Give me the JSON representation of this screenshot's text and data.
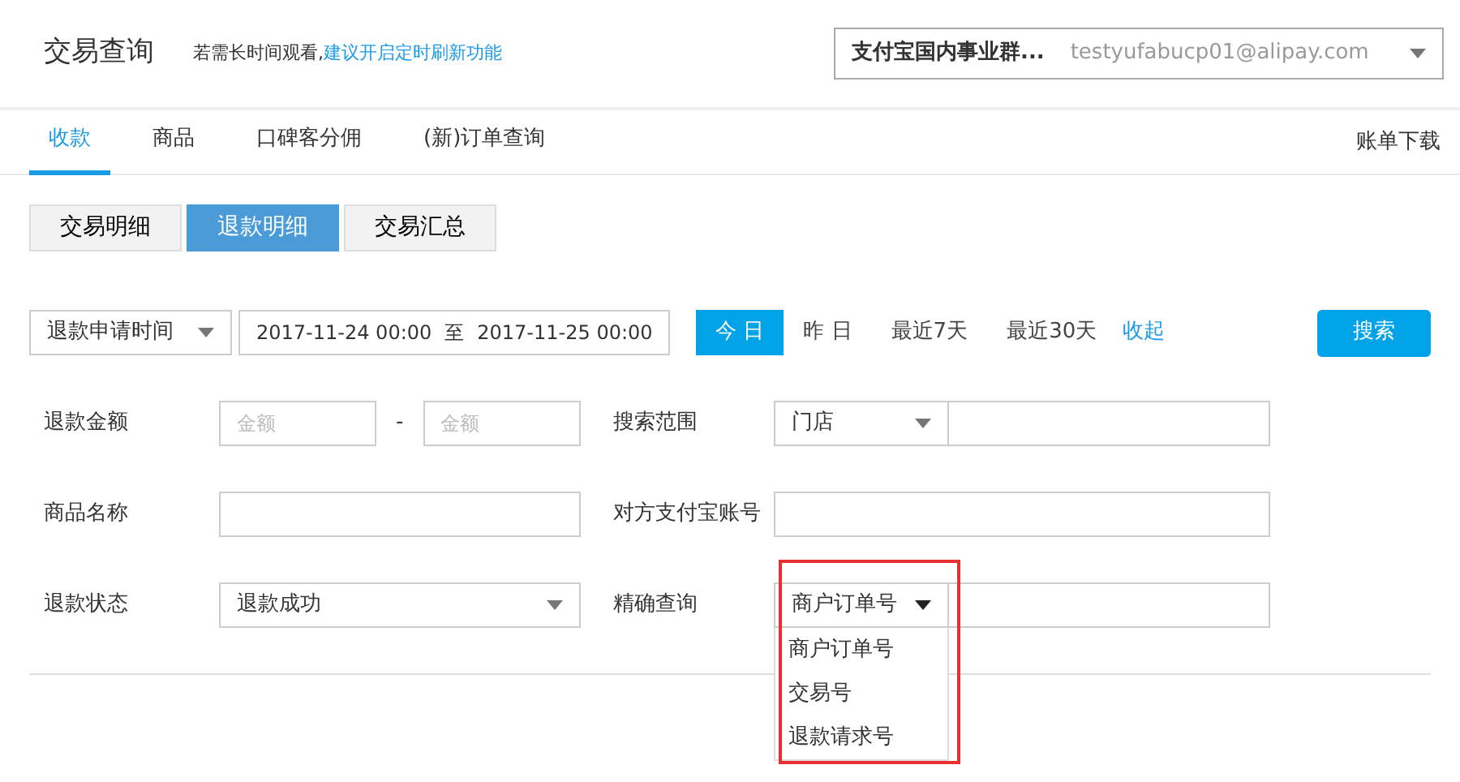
{
  "header": {
    "title": "交易查询",
    "hint": "若需长时间观看,",
    "hint_link": "建议开启定时刷新功能",
    "account": {
      "name": "支付宝国内事业群...",
      "email": "testyufabucp01@alipay.com"
    }
  },
  "tabs": [
    {
      "label": "收款",
      "selected": true
    },
    {
      "label": "商品",
      "selected": false
    },
    {
      "label": "口碑客分佣",
      "selected": false
    },
    {
      "label": "(新)订单查询",
      "selected": false
    }
  ],
  "download_link": "账单下载",
  "subtabs": [
    {
      "label": "交易明细",
      "selected": false
    },
    {
      "label": "退款明细",
      "selected": true
    },
    {
      "label": "交易汇总",
      "selected": false
    }
  ],
  "date_filter": {
    "type_select": "退款申请时间",
    "start": "2017-11-24 00:00",
    "separator": "至",
    "end": "2017-11-25 00:00",
    "quick": [
      {
        "label": "今 日",
        "selected": true
      },
      {
        "label": "昨 日",
        "selected": false
      },
      {
        "label": "最近7天",
        "selected": false
      },
      {
        "label": "最近30天",
        "selected": false
      }
    ],
    "collapse_link": "收起",
    "search_button": "搜索"
  },
  "form": [
    {
      "label": "退款金额",
      "kind": "range",
      "min_placeholder": "金额",
      "separator": "-",
      "max_placeholder": "金额"
    },
    {
      "label": "搜索范围",
      "kind": "select-input",
      "select": "门店",
      "expanded": false,
      "highlighted": false
    },
    {
      "label": "商品名称",
      "kind": "text"
    },
    {
      "label": "对方支付宝账号",
      "kind": "text"
    },
    {
      "label": "退款状态",
      "kind": "select",
      "value": "退款成功"
    },
    {
      "label": "精确查询",
      "kind": "select-input",
      "select": "商户订单号",
      "expanded": true,
      "highlighted": true,
      "options": [
        "商户订单号",
        "交易号",
        "退款请求号"
      ]
    }
  ]
}
